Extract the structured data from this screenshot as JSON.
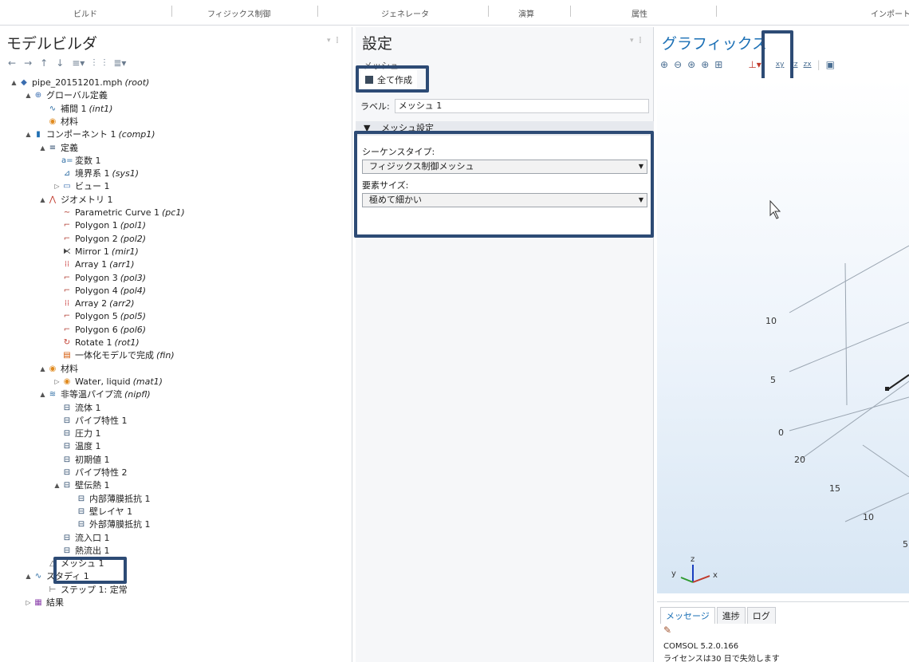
{
  "ribbon": {
    "tabs": [
      "ビルド",
      "フィジックス制御",
      "ジェネレータ",
      "演算",
      "属性",
      "インポート"
    ]
  },
  "model_builder": {
    "title": "モデルビルダ",
    "tree": [
      {
        "text": "pipe_20151201.mph",
        "tag": "(root)",
        "icon": "model-icon"
      },
      {
        "text": "グローバル定義",
        "tag": "",
        "icon": "globe-icon"
      },
      {
        "text": "補間 1",
        "tag": "(int1)",
        "icon": "interpolation-icon"
      },
      {
        "text": "材料",
        "tag": "",
        "icon": "material-icon"
      },
      {
        "text": "コンポーネント 1",
        "tag": "(comp1)",
        "icon": "component-icon"
      },
      {
        "text": "定義",
        "tag": "",
        "icon": "definitions-icon"
      },
      {
        "text": "変数 1",
        "tag": "",
        "icon": "variables-icon"
      },
      {
        "text": "境界系 1",
        "tag": "(sys1)",
        "icon": "boundary-system-icon"
      },
      {
        "text": "ビュー 1",
        "tag": "",
        "icon": "view-icon"
      },
      {
        "text": "ジオメトリ 1",
        "tag": "",
        "icon": "geometry-icon"
      },
      {
        "text": "Parametric Curve 1",
        "tag": "(pc1)",
        "icon": "parametric-curve-icon"
      },
      {
        "text": "Polygon 1",
        "tag": "(pol1)",
        "icon": "polygon-icon"
      },
      {
        "text": "Polygon 2",
        "tag": "(pol2)",
        "icon": "polygon-icon"
      },
      {
        "text": "Mirror 1",
        "tag": "(mir1)",
        "icon": "mirror-icon"
      },
      {
        "text": "Array 1",
        "tag": "(arr1)",
        "icon": "array-icon"
      },
      {
        "text": "Polygon 3",
        "tag": "(pol3)",
        "icon": "polygon-icon"
      },
      {
        "text": "Polygon 4",
        "tag": "(pol4)",
        "icon": "polygon-icon"
      },
      {
        "text": "Array 2",
        "tag": "(arr2)",
        "icon": "array-icon"
      },
      {
        "text": "Polygon 5",
        "tag": "(pol5)",
        "icon": "polygon-icon"
      },
      {
        "text": "Polygon 6",
        "tag": "(pol6)",
        "icon": "polygon-icon"
      },
      {
        "text": "Rotate 1",
        "tag": "(rot1)",
        "icon": "rotate-icon"
      },
      {
        "text": "一体化モデルで完成",
        "tag": "(fin)",
        "icon": "form-union-icon"
      },
      {
        "text": "材料",
        "tag": "",
        "icon": "material-icon"
      },
      {
        "text": "Water, liquid",
        "tag": "(mat1)",
        "icon": "material-icon"
      },
      {
        "text": "非等温パイプ流",
        "tag": "(nipfl)",
        "icon": "pipe-flow-icon"
      },
      {
        "text": "流体 1",
        "tag": "",
        "icon": "pipe-node-icon"
      },
      {
        "text": "パイプ特性 1",
        "tag": "",
        "icon": "pipe-node-icon"
      },
      {
        "text": "圧力 1",
        "tag": "",
        "icon": "pipe-node-icon"
      },
      {
        "text": "温度 1",
        "tag": "",
        "icon": "pipe-node-icon"
      },
      {
        "text": "初期値 1",
        "tag": "",
        "icon": "pipe-node-icon"
      },
      {
        "text": "パイプ特性 2",
        "tag": "",
        "icon": "pipe-node-icon"
      },
      {
        "text": "壁伝熱 1",
        "tag": "",
        "icon": "pipe-node-icon"
      },
      {
        "text": "内部薄膜抵抗 1",
        "tag": "",
        "icon": "pipe-node-icon"
      },
      {
        "text": "壁レイヤ 1",
        "tag": "",
        "icon": "pipe-node-icon"
      },
      {
        "text": "外部薄膜抵抗 1",
        "tag": "",
        "icon": "pipe-node-icon"
      },
      {
        "text": "流入口 1",
        "tag": "",
        "icon": "pipe-node-icon"
      },
      {
        "text": "熱流出 1",
        "tag": "",
        "icon": "pipe-node-icon"
      },
      {
        "text": "メッシュ 1",
        "tag": "",
        "icon": "mesh-icon"
      },
      {
        "text": "スタディ 1",
        "tag": "",
        "icon": "study-icon"
      },
      {
        "text": "ステップ 1: 定常",
        "tag": "",
        "icon": "step-icon"
      },
      {
        "text": "結果",
        "tag": "",
        "icon": "results-icon"
      }
    ]
  },
  "settings": {
    "title": "設定",
    "subtitle": "メッシュ",
    "build_all": "全て作成",
    "label_caption": "ラベル:",
    "label_value": "メッシュ 1",
    "section_title": "メッシュ設定",
    "sequence_type_label": "シーケンスタイプ:",
    "sequence_type_value": "フィジックス制御メッシュ",
    "element_size_label": "要素サイズ:",
    "element_size_value": "極めて細かい"
  },
  "graphics": {
    "title": "グラフィックス",
    "toolbar_icons": [
      "zoom-in-icon",
      "zoom-out-icon",
      "zoom-box-icon",
      "zoom-extents-icon",
      "fit-icon",
      "axis-view-icon",
      "xy-view-icon",
      "yz-view-icon",
      "zx-view-icon"
    ],
    "axis_labels": [
      "10",
      "5",
      "0",
      "20",
      "15",
      "10",
      "5"
    ],
    "triad": {
      "x": "x",
      "y": "y",
      "z": "z"
    },
    "view_labels": {
      "xy": "xy",
      "yz": "yz",
      "zx": "zx"
    }
  },
  "messages": {
    "tabs": [
      "メッセージ",
      "進捗",
      "ログ"
    ],
    "line1": "COMSOL 5.2.0.166",
    "line2": "ライセンスは30 日で失効します"
  }
}
